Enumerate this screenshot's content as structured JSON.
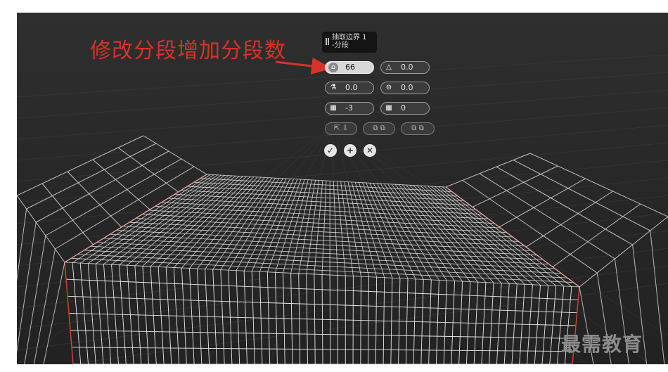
{
  "annotation": {
    "text": "修改分段增加分段数"
  },
  "caddy": {
    "title": "抽取边界 1\n-分段",
    "fields": [
      {
        "name": "segments",
        "icon": "segments-icon",
        "value": "66",
        "active": true
      },
      {
        "name": "tension",
        "icon": "tension-icon",
        "value": "0.0",
        "active": false
      },
      {
        "name": "bias",
        "icon": "bias-icon",
        "value": "0.0",
        "active": false
      },
      {
        "name": "twist",
        "icon": "twist-icon",
        "value": "0.0",
        "active": false
      },
      {
        "name": "pinch",
        "icon": "pinch-icon",
        "value": "-3",
        "active": false
      },
      {
        "name": "slide",
        "icon": "slide-icon",
        "value": "0",
        "active": false
      }
    ],
    "buttons": {
      "ok": "✓",
      "apply_continue": "+",
      "cancel": "✕"
    }
  },
  "watermark": "最需教育"
}
